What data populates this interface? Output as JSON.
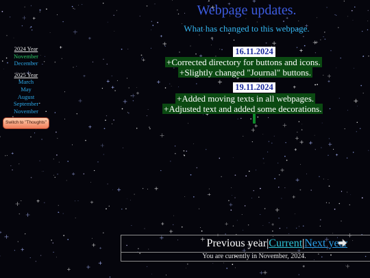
{
  "header": {
    "title": "Webpage updates.",
    "subtitle": "What has changed to this webpage."
  },
  "sidebar": {
    "years": [
      {
        "year": "2024 Year",
        "months": [
          "November",
          "December"
        ]
      },
      {
        "year": "2025 Year",
        "months": [
          "March",
          "May",
          "August",
          "September",
          "November"
        ]
      }
    ],
    "switch_button": "Switch to \"Thoughts\""
  },
  "entries": [
    {
      "date": "16.11.2024",
      "changes": [
        "+Corrected directory for buttons and icons.",
        "+Slightly changed \"Journal\" buttons."
      ]
    },
    {
      "date": "19.11.2024",
      "changes": [
        "+Added moving texts in all webpages.",
        "+Adjusted text and added some decorations."
      ]
    }
  ],
  "navigation": {
    "previous": "Previous year",
    "separator": "|",
    "current": "Current",
    "next": "Next year",
    "arrow_icon": "arrow-right-icon",
    "status": "You are currently in November, 2024."
  },
  "colors": {
    "background": "#05050c",
    "title": "#3d5ce0",
    "subtitle": "#34b6f0",
    "change_highlight": "#0b4a12",
    "date_text": "#1a2a9c"
  }
}
